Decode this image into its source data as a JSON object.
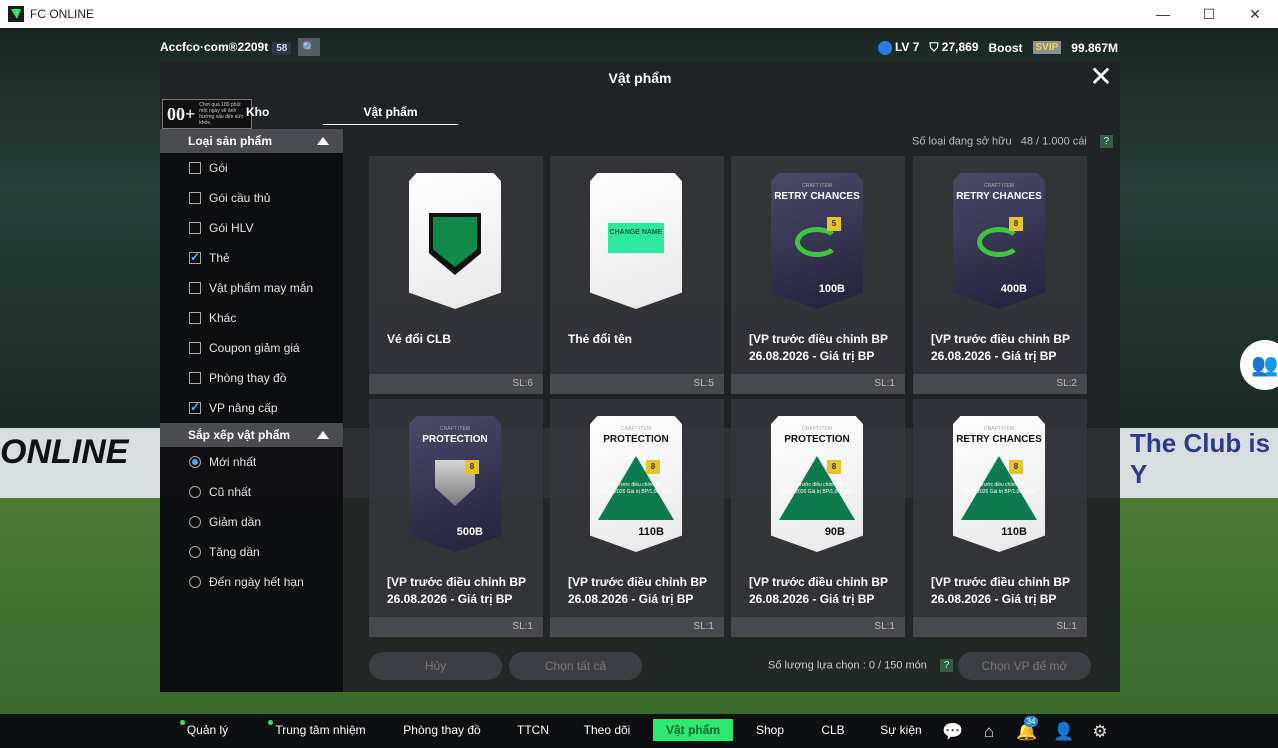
{
  "window": {
    "title": "FC ONLINE",
    "min": "—",
    "max": "☐",
    "close": "✕"
  },
  "background": {
    "banner_left": "ONLINE",
    "banner_right": "The Club is Y"
  },
  "topbar": {
    "account": "Accfco·com®2209t",
    "account_level": "58",
    "level": "LV 7",
    "coins": "27,869",
    "boost": "Boost",
    "svip": "SVIP",
    "bp": "99.867M"
  },
  "modal": {
    "title": "Vật phẩm",
    "close": "✕",
    "rating_big": "00+",
    "rating_small": "Chơi quá 180 phút một ngày sẽ ảnh hưởng xấu đến sức khỏe.",
    "kho_tab": "Kho",
    "item_tab": "Vật phẩm",
    "owned_label": "Số loại đang sở hữu",
    "owned_value": "48 / 1.000 cái",
    "help": "?"
  },
  "sidebar": {
    "section1": "Loại sản phẩm",
    "types": [
      {
        "label": "Gói",
        "checked": false
      },
      {
        "label": "Gói cầu thủ",
        "checked": false
      },
      {
        "label": "Gói HLV",
        "checked": false
      },
      {
        "label": "Thẻ",
        "checked": true
      },
      {
        "label": "Vật phẩm may mắn",
        "checked": false
      },
      {
        "label": "Khác",
        "checked": false
      },
      {
        "label": "Coupon giảm giá",
        "checked": false
      },
      {
        "label": "Phòng thay đồ",
        "checked": false
      },
      {
        "label": "VP nâng cấp",
        "checked": true
      }
    ],
    "section2": "Sắp xếp vật phẩm",
    "sorts": [
      {
        "label": "Mới nhất",
        "selected": true
      },
      {
        "label": "Cũ nhất",
        "selected": false
      },
      {
        "label": "Giảm dần",
        "selected": false
      },
      {
        "label": "Tăng dần",
        "selected": false
      },
      {
        "label": "Đến ngày hết hạn",
        "selected": false
      }
    ]
  },
  "items": [
    {
      "name": "Vé đổi CLB",
      "qty": "SL:6",
      "art": "white",
      "kind": "club",
      "art_title": "",
      "craft": "",
      "boost": "",
      "value": "",
      "tri_text": "",
      "name_box": ""
    },
    {
      "name": "Thẻ đổi tên",
      "qty": "SL:5",
      "art": "white",
      "kind": "rename",
      "art_title": "",
      "craft": "",
      "boost": "",
      "value": "",
      "tri_text": "",
      "name_box": "CHANGE NAME"
    },
    {
      "name": "[VP trước điều chỉnh BP 26.08.2026 - Giá trị BP",
      "qty": "SL:1",
      "art": "dark",
      "kind": "retry",
      "art_title": "RETRY CHANCES",
      "craft": "CRAFT ITEM",
      "boost": "5",
      "value": "100B",
      "tri_text": "",
      "name_box": ""
    },
    {
      "name": "[VP trước điều chỉnh BP 26.08.2026 - Giá trị BP",
      "qty": "SL:2",
      "art": "dark",
      "kind": "retry",
      "art_title": "RETRY CHANCES",
      "craft": "CRAFT ITEM",
      "boost": "8",
      "value": "400B",
      "tri_text": "",
      "name_box": ""
    },
    {
      "name": "[VP trước điều chỉnh BP 26.08.2026 - Giá trị BP",
      "qty": "SL:1",
      "art": "dark",
      "kind": "shield",
      "art_title": "PROTECTION",
      "craft": "CRAFT ITEM",
      "boost": "8",
      "value": "500B",
      "tri_text": "",
      "name_box": ""
    },
    {
      "name": "[VP trước điều chỉnh BP 26.08.2026 - Giá trị BP",
      "qty": "SL:1",
      "art": "white",
      "kind": "tri",
      "art_title": "PROTECTION",
      "craft": "CRAFT ITEM",
      "boost": "8",
      "value": "110B",
      "tri_text": "VP trước điều chỉnh BP 26.08.2026 Giá trị BP/1,000,000",
      "name_box": ""
    },
    {
      "name": "[VP trước điều chỉnh BP 26.08.2026 - Giá trị BP",
      "qty": "SL:1",
      "art": "white",
      "kind": "tri",
      "art_title": "PROTECTION",
      "craft": "CRAFT ITEM",
      "boost": "8",
      "value": "90B",
      "tri_text": "VP trước điều chỉnh BP 26.08.2026 Giá trị BP/1,000,000",
      "name_box": ""
    },
    {
      "name": "[VP trước điều chỉnh BP 26.08.2026 - Giá trị BP",
      "qty": "SL:1",
      "art": "white",
      "kind": "tri",
      "art_title": "RETRY CHANCES",
      "craft": "CRAFT ITEM",
      "boost": "8",
      "value": "110B",
      "tri_text": "VP trước điều chỉnh BP 26.08.2026 Giá trị BP/1,000,000",
      "name_box": ""
    }
  ],
  "footer": {
    "cancel": "Hủy",
    "select_all": "Chọn tất cả",
    "select_count": "Số lượng lựa chọn : 0 / 150 món",
    "help": "?",
    "open": "Chọn VP để mở"
  },
  "nav": {
    "items": [
      "Quản lý CT",
      "Trung tâm nhiệm vụ",
      "Phòng thay đồ",
      "TTCN",
      "Theo dõi",
      "Vật phẩm",
      "Shop",
      "CLB",
      "Sự kiện"
    ],
    "active": "Vật phẩm",
    "notif_count": "34"
  }
}
